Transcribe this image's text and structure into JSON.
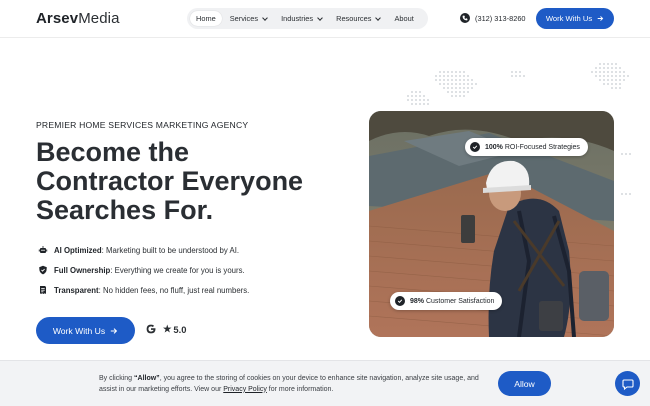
{
  "brand": {
    "name_bold": "Arsev",
    "name_regular": "Media"
  },
  "nav": {
    "items": [
      {
        "label": "Home",
        "active": true,
        "dropdown": false
      },
      {
        "label": "Services",
        "active": false,
        "dropdown": true
      },
      {
        "label": "Industries",
        "active": false,
        "dropdown": true
      },
      {
        "label": "Resources",
        "active": false,
        "dropdown": true
      },
      {
        "label": "About",
        "active": false,
        "dropdown": false
      }
    ]
  },
  "header": {
    "phone": "(312) 313-8260",
    "cta_label": "Work With Us",
    "cta_icon": "arrow-right-icon"
  },
  "hero": {
    "eyebrow": "PREMIER HOME SERVICES MARKETING AGENCY",
    "headline_line1": "Become the",
    "headline_line2": "Contractor Everyone",
    "headline_line3": "Searches For.",
    "features": [
      {
        "icon": "robot-icon",
        "title": "AI Optimized",
        "text": ": Marketing built to be understood by AI."
      },
      {
        "icon": "shield-icon",
        "title": "Full Ownership",
        "text": ": Everything we create for you is yours."
      },
      {
        "icon": "receipt-icon",
        "title": "Transparent",
        "text": ": No hidden fees, no fluff, just real numbers."
      }
    ],
    "cta_label": "Work With Us",
    "rating": "5.0",
    "rating_star": "★"
  },
  "image_badges": {
    "top": {
      "bold": "100%",
      "text": " ROI-Focused Strategies"
    },
    "bottom": {
      "bold": "98%",
      "text": " Customer Satisfaction"
    }
  },
  "cookie": {
    "text_before": "By clicking ",
    "allow_quoted": "“Allow”",
    "text_after": ", you agree to the storing of cookies on your device to enhance site navigation, analyze site usage, and assist in our marketing efforts. View our ",
    "privacy_link": "Privacy Policy",
    "text_end": " for more information.",
    "allow_label": "Allow"
  },
  "colors": {
    "accent": "#1e5bc6",
    "text": "#1f2328",
    "cookie_bg": "#f2f3f5"
  }
}
